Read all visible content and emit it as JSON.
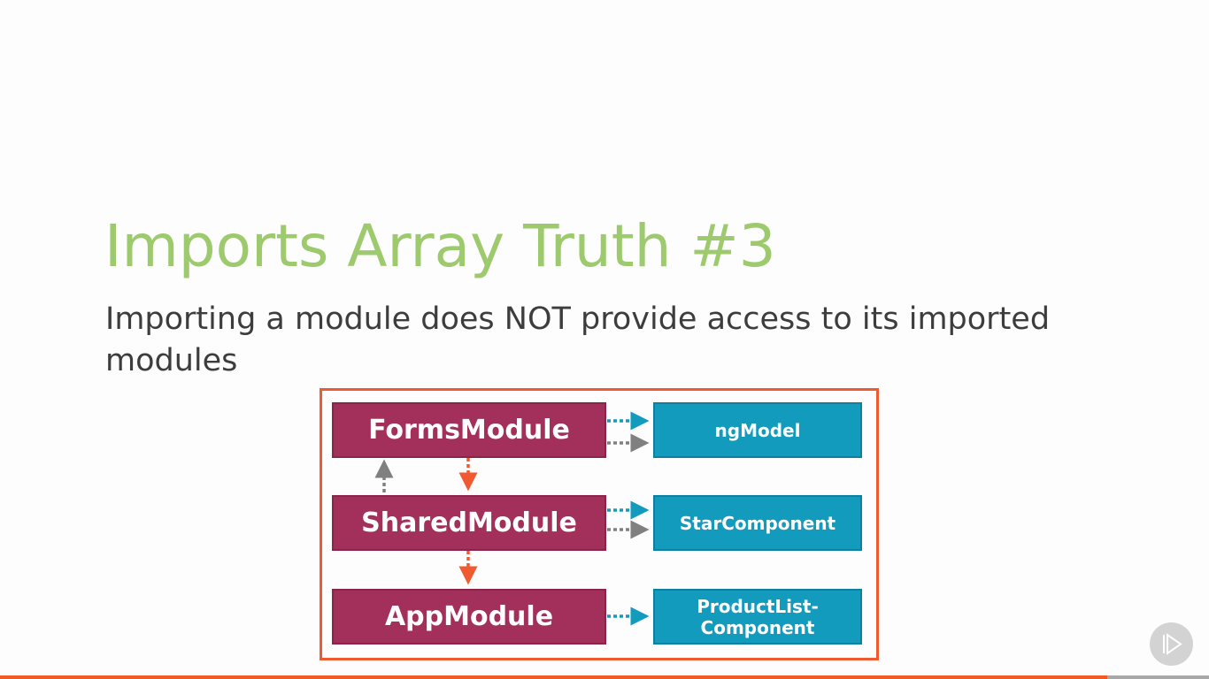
{
  "slide": {
    "title": "Imports Array Truth #3",
    "subtitle": "Importing a module does NOT provide access to its imported modules"
  },
  "diagram": {
    "modules": [
      "FormsModule",
      "SharedModule",
      "AppModule"
    ],
    "components": [
      "ngModel",
      "StarComponent",
      "ProductList-\nComponent"
    ],
    "colors": {
      "module": "#a3305a",
      "component": "#139bbd",
      "frame": "#f05a30",
      "import_arrow": "#f05a30",
      "declare_arrow": "#139bbd",
      "export_arrow": "#808080"
    }
  },
  "player": {
    "icon": "pluralsight-play-icon",
    "progress_percent": 91.6,
    "progress_color": "#f15a24"
  }
}
